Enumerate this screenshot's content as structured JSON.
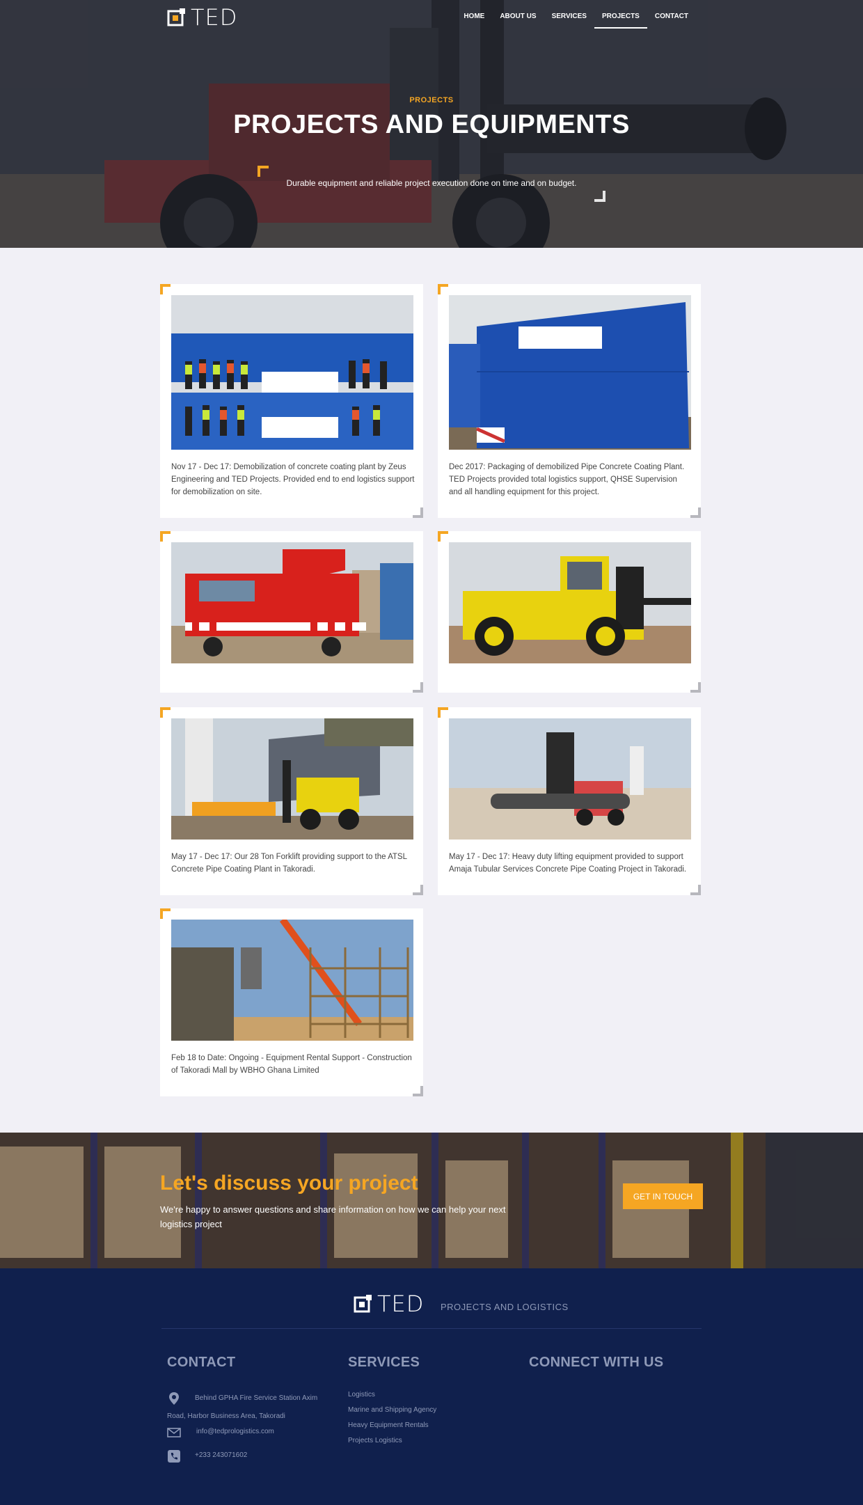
{
  "nav": {
    "logo_text": "TED",
    "items": [
      {
        "label": "HOME",
        "active": false
      },
      {
        "label": "ABOUT US",
        "active": false
      },
      {
        "label": "SERVICES",
        "active": false
      },
      {
        "label": "PROJECTS",
        "active": true
      },
      {
        "label": "CONTACT",
        "active": false
      }
    ]
  },
  "hero": {
    "eyebrow": "PROJECTS",
    "title": "PROJECTS AND EQUIPMENTS",
    "description": "Durable equipment and reliable project execution done on time and on budget."
  },
  "projects": [
    {
      "caption": "Nov 17 - Dec 17: Demobilization of concrete coating plant by Zeus Engineering and TED Projects. Provided end to end logistics support for demobilization on site.",
      "photo": "team-with-banners"
    },
    {
      "caption": "Dec 2017: Packaging of demobilized Pipe Concrete Coating Plant. TED Projects provided total logistics support, QHSE Supervision and all handling equipment for this project.",
      "photo": "blue-packaged-crate"
    },
    {
      "caption": "",
      "photo": "red-grove-crane"
    },
    {
      "caption": "",
      "photo": "yellow-forklift"
    },
    {
      "caption": "May 17 - Dec 17: Our 28 Ton Forklift providing support to the ATSL Concrete Pipe Coating Plant in Takoradi.",
      "photo": "forklift-at-plant"
    },
    {
      "caption": "May 17 - Dec 17: Heavy duty lifting equipment provided to support Amaja Tubular Services Concrete Pipe Coating Project in Takoradi.",
      "photo": "forklift-carrying-pipe"
    },
    {
      "caption": "Feb 18 to Date: Ongoing - Equipment Rental Support - Construction of Takoradi Mall by WBHO Ghana Limited",
      "photo": "crane-and-scaffolding"
    }
  ],
  "cta": {
    "title": "Let's discuss your project",
    "text": "We're happy to answer questions and share information on how we can help your next logistics project",
    "button": "GET IN TOUCH"
  },
  "footer": {
    "logo_text": "TED",
    "tagline": "PROJECTS AND LOGISTICS",
    "contact": {
      "heading": "CONTACT",
      "address_line1": "Behind GPHA Fire Service Station Axim",
      "address_line2": "Road, Harbor Business Area, Takoradi",
      "email": "info@tedprologistics.com",
      "phone": "+233 243071602"
    },
    "services": {
      "heading": "SERVICES",
      "items": [
        "Logistics",
        "Marine and Shipping Agency",
        "Heavy Equipment Rentals",
        "Projects Logistics"
      ]
    },
    "connect": {
      "heading": "CONNECT WITH US"
    }
  },
  "colors": {
    "accent": "#f5a623",
    "footer_bg": "#10204d",
    "page_bg": "#f1f0f6"
  }
}
